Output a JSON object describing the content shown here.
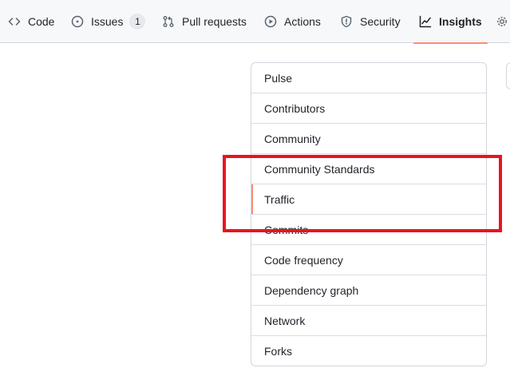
{
  "repo_nav": {
    "tabs": [
      {
        "label": "Code",
        "icon": "code-icon"
      },
      {
        "label": "Issues",
        "icon": "issue-opened-icon",
        "counter": "1"
      },
      {
        "label": "Pull requests",
        "icon": "git-pull-request-icon"
      },
      {
        "label": "Actions",
        "icon": "play-icon"
      },
      {
        "label": "Security",
        "icon": "shield-icon"
      },
      {
        "label": "Insights",
        "icon": "graph-icon",
        "selected": true
      },
      {
        "label": "",
        "icon": "gear-icon"
      }
    ]
  },
  "insights_menu": {
    "items": [
      {
        "label": "Pulse"
      },
      {
        "label": "Contributors"
      },
      {
        "label": "Community"
      },
      {
        "label": "Community Standards"
      },
      {
        "label": "Traffic",
        "selected": true
      },
      {
        "label": "Commits"
      },
      {
        "label": "Code frequency"
      },
      {
        "label": "Dependency graph"
      },
      {
        "label": "Network"
      },
      {
        "label": "Forks"
      }
    ]
  },
  "colors": {
    "accent_underline": "#fd8c73",
    "highlight_box": "#e8141e",
    "border": "#d0d7de",
    "text": "#1f2328"
  }
}
